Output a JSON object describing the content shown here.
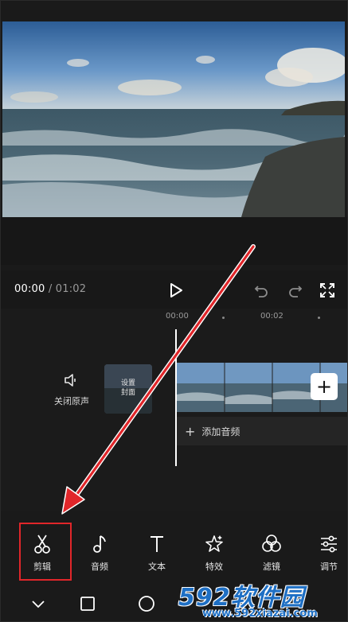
{
  "playback": {
    "current_time": "00:00",
    "separator": "/",
    "total_time": "01:02"
  },
  "icons": {
    "play": "play-icon",
    "undo": "undo-icon",
    "redo": "redo-icon",
    "fullscreen": "fullscreen-icon"
  },
  "ruler": {
    "labels": [
      "00:00",
      "00:02"
    ]
  },
  "track": {
    "mute_label": "关闭原声",
    "cover_label_line1": "设置",
    "cover_label_line2": "封面",
    "add_audio_label": "添加音频",
    "add_clip_symbol": "+"
  },
  "toolbar": {
    "items": [
      {
        "label": "剪辑",
        "icon": "scissors-icon"
      },
      {
        "label": "音频",
        "icon": "music-note-icon"
      },
      {
        "label": "文本",
        "icon": "text-icon"
      },
      {
        "label": "特效",
        "icon": "sparkle-star-icon"
      },
      {
        "label": "滤镜",
        "icon": "filter-circles-icon"
      },
      {
        "label": "调节",
        "icon": "sliders-icon"
      }
    ]
  },
  "navbar": {
    "items": [
      "back-chevron-icon",
      "square-icon",
      "circle-icon"
    ]
  },
  "watermark": {
    "brand": "592软件园",
    "url": "www.592xiazai.com"
  },
  "colors": {
    "highlight": "#e1262a",
    "arrow": "#e1262a",
    "watermark": "#1e6fc4",
    "background": "#1a1a1a"
  }
}
